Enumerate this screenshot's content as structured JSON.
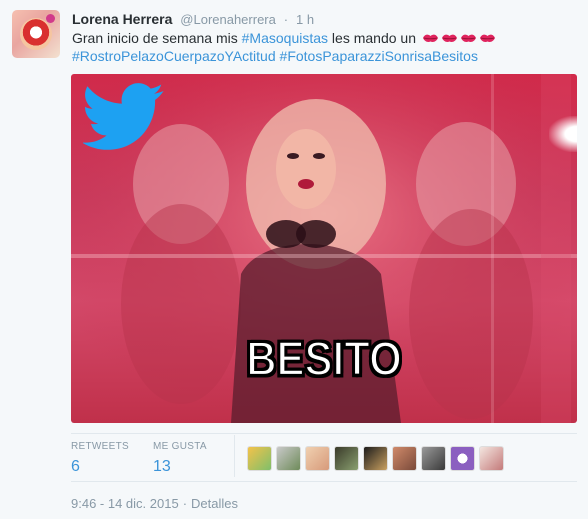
{
  "tweet": {
    "author_name": "Lorena Herrera",
    "author_handle": "@Lorenaherrera",
    "separator": "·",
    "time_ago": "1 h",
    "text_part1": "Gran inicio de semana mis ",
    "hashtag1": "#Masoquistas",
    "text_part2": " les mando un ",
    "hashtag2": "#RostroPelazoCuerpazoYActitud",
    "hashtag3": "#FotosPaparazziSonrisaBesitos",
    "emoji_icons": [
      "kiss-lips-icon",
      "kiss-lips-icon",
      "kiss-lips-icon",
      "kiss-lips-icon"
    ]
  },
  "media": {
    "caption": "BESITO",
    "watermark_icon": "twitter-bird-icon"
  },
  "stats": {
    "retweets_label": "RETWEETS",
    "retweets_value": "6",
    "likes_label": "ME GUSTA",
    "likes_value": "13",
    "liker_avatars": 9
  },
  "meta": {
    "timestamp": "9:46 - 14 dic. 2015",
    "separator": "·",
    "details_link": "Detalles"
  },
  "colors": {
    "link": "#3b94d9",
    "muted": "#8899a6",
    "twitter_blue": "#55acee",
    "media_tint": "#d12a4a"
  }
}
